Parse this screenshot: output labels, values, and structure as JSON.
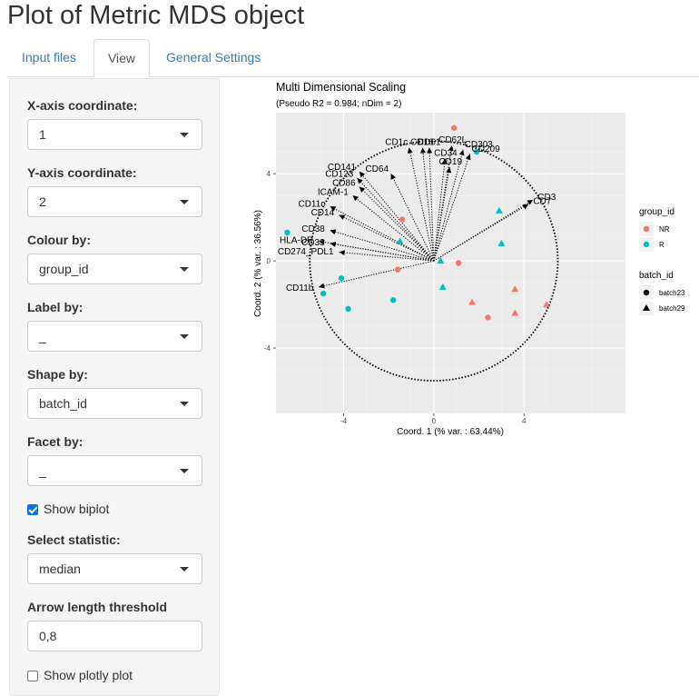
{
  "page": {
    "title": "Plot of Metric MDS object"
  },
  "tabs": [
    {
      "label": "Input files"
    },
    {
      "label": "View"
    },
    {
      "label": "General Settings"
    }
  ],
  "sidebar": {
    "x_axis": {
      "label": "X-axis coordinate:",
      "value": "1"
    },
    "y_axis": {
      "label": "Y-axis coordinate:",
      "value": "2"
    },
    "colour_by": {
      "label": "Colour by:",
      "value": "group_id"
    },
    "label_by": {
      "label": "Label by:",
      "value": "_"
    },
    "shape_by": {
      "label": "Shape by:",
      "value": "batch_id"
    },
    "facet_by": {
      "label": "Facet by:",
      "value": "_"
    },
    "show_biplot": {
      "label": "Show biplot",
      "checked": true
    },
    "statistic": {
      "label": "Select statistic:",
      "value": "median"
    },
    "arrow_threshold": {
      "label": "Arrow length threshold",
      "value": "0,8"
    },
    "show_plotly": {
      "label": "Show plotly plot",
      "checked": false
    }
  },
  "chart_data": {
    "type": "scatter",
    "title": "Multi Dimensional Scaling",
    "subtitle": "(Pseudo R2 = 0.984; nDim = 2)",
    "xlabel": "Coord. 1 (% var. : 63.44%)",
    "ylabel": "Coord. 2 (% var. : 36.56%)",
    "xlim": [
      -7,
      8.5
    ],
    "ylim": [
      -7,
      6.8
    ],
    "xticks": [
      -4,
      0,
      4
    ],
    "yticks": [
      -4,
      0,
      4
    ],
    "tick_labels": [
      "-4",
      "0",
      "4"
    ],
    "grid": true,
    "colors": {
      "NR": "#f8766d",
      "R": "#00bfc4",
      "background": "#ebebeb",
      "arrow": "#000000"
    },
    "circle_radius": 5.5,
    "legends": [
      {
        "title": "group_id",
        "entries": [
          "NR",
          "R"
        ]
      },
      {
        "title": "batch_id",
        "entries": [
          "batch23",
          "batch29"
        ]
      }
    ],
    "points": [
      {
        "x": 0.9,
        "y": 6.1,
        "group": "NR",
        "batch": "batch23"
      },
      {
        "x": -1.4,
        "y": 1.9,
        "group": "NR",
        "batch": "batch23"
      },
      {
        "x": -1.6,
        "y": -0.4,
        "group": "NR",
        "batch": "batch23"
      },
      {
        "x": 1.1,
        "y": -0.1,
        "group": "NR",
        "batch": "batch23"
      },
      {
        "x": 2.4,
        "y": -2.6,
        "group": "NR",
        "batch": "batch23"
      },
      {
        "x": 1.7,
        "y": -1.9,
        "group": "NR",
        "batch": "batch29"
      },
      {
        "x": 3.6,
        "y": -1.3,
        "group": "NR",
        "batch": "batch29"
      },
      {
        "x": 3.6,
        "y": -2.4,
        "group": "NR",
        "batch": "batch29"
      },
      {
        "x": 5.0,
        "y": -2.0,
        "group": "NR",
        "batch": "batch29"
      },
      {
        "x": -6.5,
        "y": 1.3,
        "group": "R",
        "batch": "batch23"
      },
      {
        "x": -4.1,
        "y": -0.8,
        "group": "R",
        "batch": "batch23"
      },
      {
        "x": -4.9,
        "y": -1.5,
        "group": "R",
        "batch": "batch23"
      },
      {
        "x": -3.8,
        "y": -2.2,
        "group": "R",
        "batch": "batch23"
      },
      {
        "x": -1.8,
        "y": -1.8,
        "group": "R",
        "batch": "batch23"
      },
      {
        "x": 1.9,
        "y": 5.0,
        "group": "R",
        "batch": "batch23"
      },
      {
        "x": -1.5,
        "y": 0.9,
        "group": "R",
        "batch": "batch29"
      },
      {
        "x": 0.3,
        "y": 0.0,
        "group": "R",
        "batch": "batch29"
      },
      {
        "x": 0.4,
        "y": -1.2,
        "group": "R",
        "batch": "batch29"
      },
      {
        "x": 2.9,
        "y": 2.3,
        "group": "R",
        "batch": "batch29"
      },
      {
        "x": 3.0,
        "y": 0.8,
        "group": "R",
        "batch": "batch29"
      }
    ],
    "arrows": [
      {
        "label": "CD62L",
        "x": 0.8,
        "y": 5.3
      },
      {
        "label": "CD303",
        "x": 1.3,
        "y": 5.1
      },
      {
        "label": "CD34",
        "x": 0.5,
        "y": 4.7
      },
      {
        "label": "CD19",
        "x": 0.7,
        "y": 4.3
      },
      {
        "label": "CD209",
        "x": 1.6,
        "y": 4.9
      },
      {
        "label": "CD1c",
        "x": -1.1,
        "y": 5.2
      },
      {
        "label": "CD61",
        "x": -0.2,
        "y": 5.2
      },
      {
        "label": "CD16",
        "x": -0.5,
        "y": 5.2
      },
      {
        "label": "CD64",
        "x": -1.9,
        "y": 4.0
      },
      {
        "label": "CD141",
        "x": -3.3,
        "y": 4.1
      },
      {
        "label": "CD123",
        "x": -3.4,
        "y": 3.8
      },
      {
        "label": "ICAM-1",
        "x": -3.6,
        "y": 3.0
      },
      {
        "label": "CD86",
        "x": -3.3,
        "y": 3.4
      },
      {
        "label": "CD11c",
        "x": -4.6,
        "y": 2.5
      },
      {
        "label": "CD14",
        "x": -4.2,
        "y": 2.1
      },
      {
        "label": "CD38",
        "x": -4.6,
        "y": 1.4
      },
      {
        "label": "HLA-DR",
        "x": -5.1,
        "y": 0.9
      },
      {
        "label": "CD33",
        "x": -4.6,
        "y": 0.8
      },
      {
        "label": "CD274_PDL1",
        "x": -4.2,
        "y": 0.4
      },
      {
        "label": "CD11b",
        "x": -5.1,
        "y": -1.2
      },
      {
        "label": "CD3",
        "x": 4.4,
        "y": 2.8
      },
      {
        "label": "CD7",
        "x": 4.2,
        "y": 2.6
      }
    ]
  }
}
